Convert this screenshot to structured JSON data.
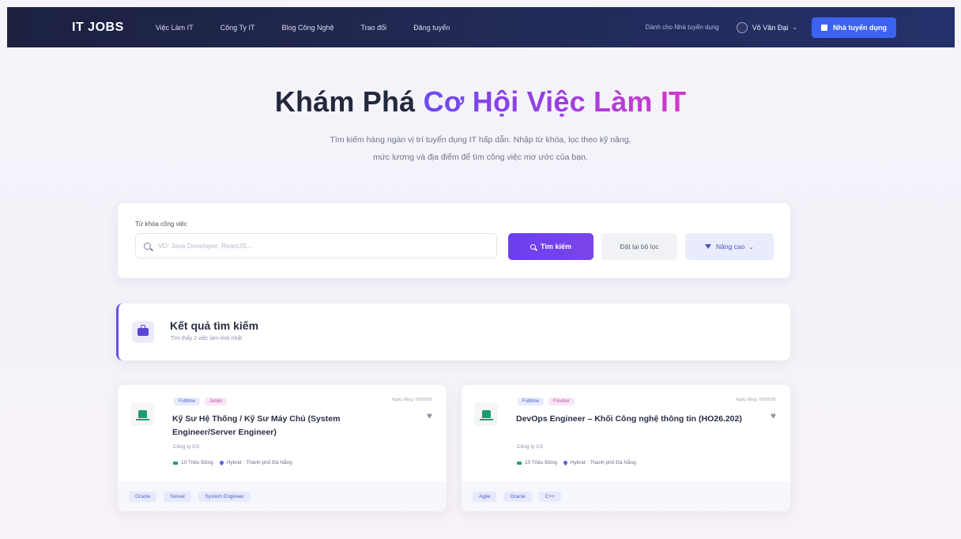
{
  "nav": {
    "logo": "IT JOBS",
    "links": [
      "Việc Làm IT",
      "Công Ty IT",
      "Blog Công Nghệ",
      "Trao đổi",
      "Đăng tuyển"
    ],
    "employer_link": "Dành cho Nhà tuyển dụng",
    "user_name": "Võ Văn Đại",
    "post_button": "Nhà tuyển dụng"
  },
  "hero": {
    "title_plain": "Khám Phá",
    "title_highlight": "Cơ Hội Việc Làm IT",
    "subtitle_line1": "Tìm kiếm hàng ngàn vị trí tuyển dụng IT hấp dẫn. Nhập từ khóa, lọc theo kỹ năng,",
    "subtitle_line2": "mức lương và địa điểm để tìm công việc mơ ước của bạn."
  },
  "search": {
    "label": "Từ khóa công việc",
    "placeholder": "VD: Java Developer, ReactJS...",
    "search_button": "Tìm kiếm",
    "reset_button": "Đặt lại bộ lọc",
    "advanced_button": "Nâng cao"
  },
  "results": {
    "title": "Kết quả tìm kiếm",
    "subtitle": "Tìm thấy 2 việc làm mới nhất"
  },
  "jobs": [
    {
      "tags": [
        "Fulltime",
        "Junior"
      ],
      "posted": "Ngày đăng: 05/06/26",
      "title": "Kỹ Sư Hệ Thống / Kỹ Sư Máy Chủ (System Engineer/Server Engineer)",
      "company": "Công ty CS",
      "salary": "10 Triệu Đồng",
      "location": "Hybrid · Thành phố Đà Nẵng",
      "skills": [
        "Oracle",
        "Server",
        "System Engineer"
      ]
    },
    {
      "tags": [
        "Fulltime",
        "Fresher"
      ],
      "posted": "Ngày đăng: 05/06/26",
      "title": "DevOps Engineer – Khối Công nghệ thông tin (HO26.202)",
      "company": "Công ty CS",
      "salary": "10 Triệu Đồng",
      "location": "Hybrid · Thành phố Đà Nẵng",
      "skills": [
        "Agile",
        "Oracle",
        "C++"
      ]
    }
  ],
  "colors": {
    "nav_bg": "#1c2140",
    "accent_purple": "#6a3ff0",
    "accent_pink": "#d23ac8",
    "post_button_bg": "#3b63f0"
  },
  "icons": [
    "search-icon",
    "filter-icon",
    "briefcase-icon",
    "company-logo-icon",
    "heart-icon",
    "money-icon",
    "location-icon",
    "chevron-down-icon",
    "avatar-icon"
  ]
}
